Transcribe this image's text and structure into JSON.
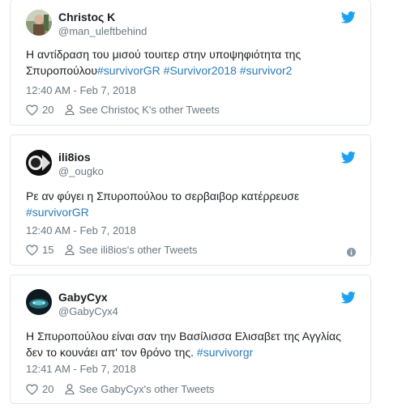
{
  "tweets": [
    {
      "name": "Christoς K",
      "handle": "@man_uleftbehind",
      "text_plain": "Η αντίδραση του μισού τουιτερ στην υποψηφιότητα της Σπυροπούλου",
      "hashtags": [
        "#survivorGR",
        "#Survivor2018",
        "#survivor2"
      ],
      "time": "12:40 AM - Feb 7, 2018",
      "likes": "20",
      "see_other": "See Christoς K's other Tweets",
      "avatar_icon": "avatar-photo-icon"
    },
    {
      "name": "ili8ios",
      "handle": "@_ougko",
      "text_plain": "Ρε αν φύγει η Σπυροπούλου το σερβαιβορ κατέρρευσε",
      "hashtags": [
        "#survivorGR"
      ],
      "time": "12:40 AM - Feb 7, 2018",
      "likes": "15",
      "see_other": "See ili8ios's other Tweets",
      "avatar_icon": "avatar-photo-icon"
    },
    {
      "name": "GabyCyx",
      "handle": "@GabyCyx4",
      "text_plain": "Η Σπυροπούλου είναι σαν την Βασίλισσα Ελισαβετ της Αγγλίας δεν το κουνάει απ' τον θρόνο της.",
      "hashtags": [
        "#survivorgr"
      ],
      "time": "12:41 AM - Feb 7, 2018",
      "likes": "20",
      "see_other": "See GabyCyx's other Tweets",
      "avatar_icon": "avatar-photo-icon"
    }
  ],
  "colors": {
    "link": "#2b7bb9",
    "twitter_bird": "#1da1f2",
    "muted": "#697882",
    "border": "#e1e8ed"
  }
}
